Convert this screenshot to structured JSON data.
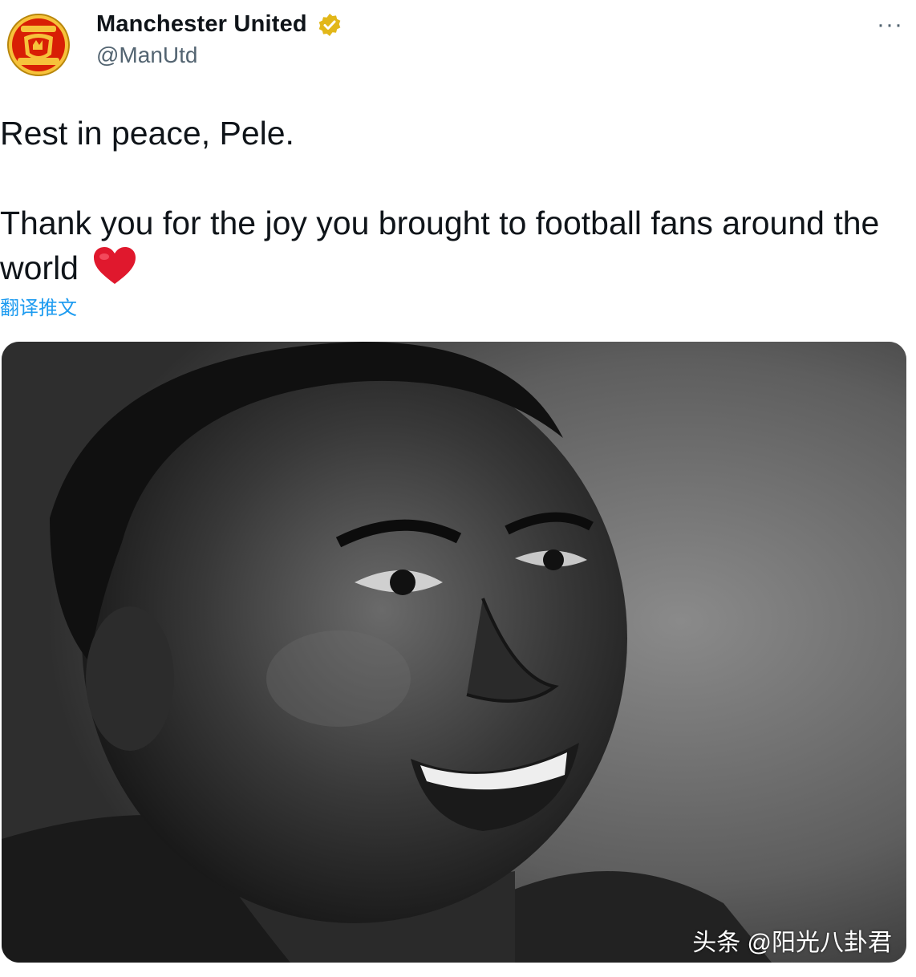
{
  "tweet": {
    "author": {
      "display_name": "Manchester United",
      "handle": "@ManUtd",
      "verified": true,
      "avatar_icon": "manutd-crest-icon",
      "badge_icon": "verified-gold-badge-icon",
      "badge_color": "#e2b719"
    },
    "more_label": "···",
    "text": {
      "line1": "Rest in peace, Pele.",
      "line2": "Thank you for the joy you brought to football fans around the world",
      "emoji_icon": "red-heart-icon"
    },
    "translate_label": "翻译推文",
    "media": {
      "type": "photo",
      "watermark": "头条 @阳光八卦君"
    }
  },
  "colors": {
    "text_primary": "#0f1419",
    "text_secondary": "#536471",
    "link": "#1d9bf0",
    "heart": "#e0182d",
    "crest_red": "#d81e05",
    "crest_gold": "#f6c23b"
  }
}
